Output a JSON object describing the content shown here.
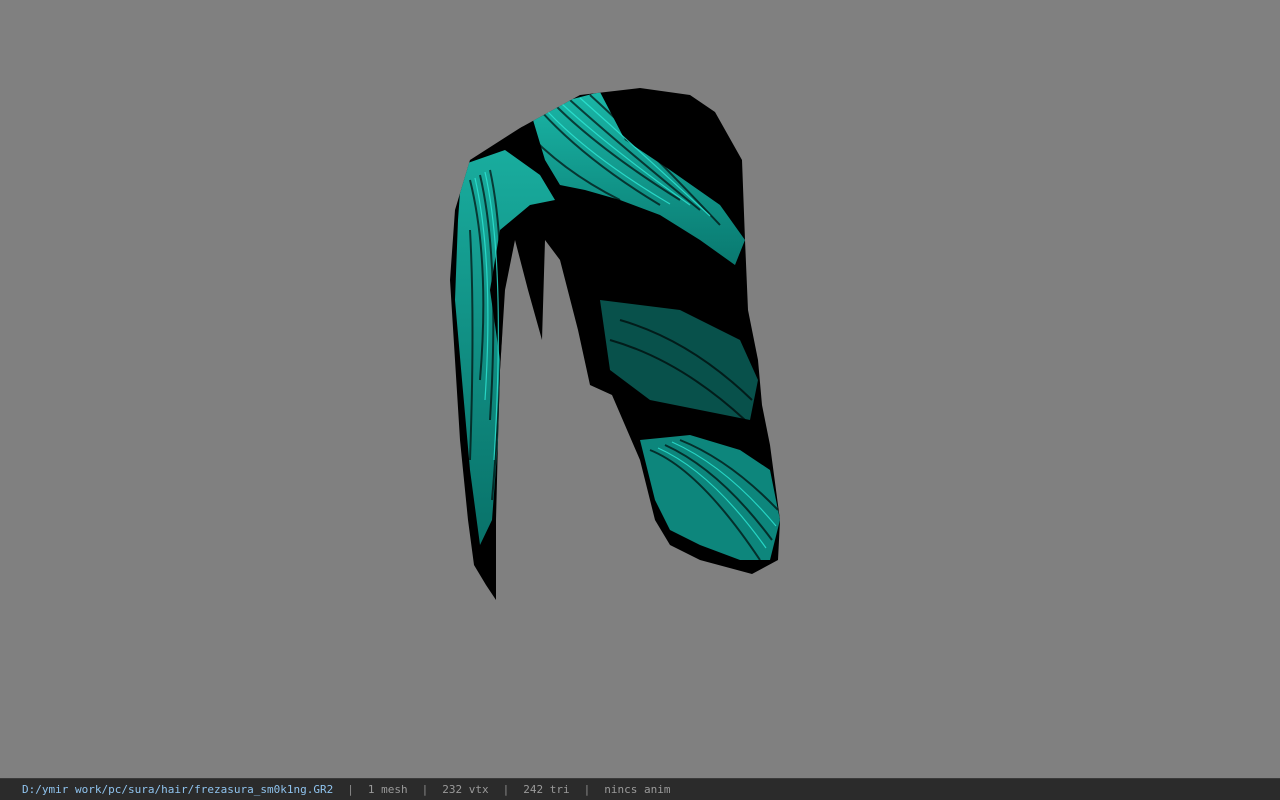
{
  "viewport": {
    "background": "#808080",
    "model": {
      "kind": "hair-mesh",
      "base_color": "#000000",
      "highlight_color": "#1fd6c4"
    }
  },
  "statusbar": {
    "file_path": "D:/ymir work/pc/sura/hair/frezasura_sm0k1ng.GR2",
    "mesh_count": "1 mesh",
    "vertex_count": "232 vtx",
    "triangle_count": "242 tri",
    "anim_info": "nincs anim",
    "separator": "|"
  }
}
